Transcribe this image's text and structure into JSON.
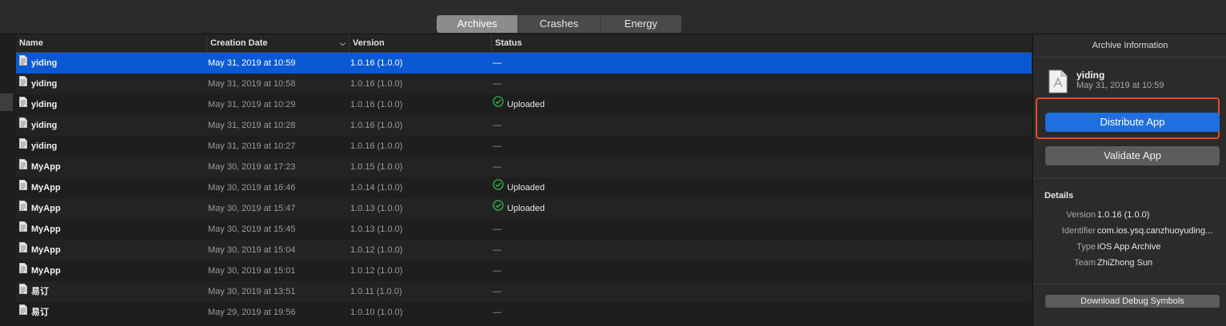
{
  "toolbar": {
    "tabs": [
      {
        "label": "Archives",
        "active": true
      },
      {
        "label": "Crashes",
        "active": false
      },
      {
        "label": "Energy",
        "active": false
      }
    ]
  },
  "table": {
    "columns": [
      "Name",
      "Creation Date",
      "Version",
      "Status"
    ],
    "rows": [
      {
        "name": "yiding",
        "date": "May 31, 2019 at 10:59",
        "version": "1.0.16 (1.0.0)",
        "status": "—",
        "uploaded": false,
        "selected": true
      },
      {
        "name": "yiding",
        "date": "May 31, 2019 at 10:58",
        "version": "1.0.16 (1.0.0)",
        "status": "—",
        "uploaded": false
      },
      {
        "name": "yiding",
        "date": "May 31, 2019 at 10:29",
        "version": "1.0.16 (1.0.0)",
        "status": "Uploaded",
        "uploaded": true
      },
      {
        "name": "yiding",
        "date": "May 31, 2019 at 10:28",
        "version": "1.0.16 (1.0.0)",
        "status": "—",
        "uploaded": false
      },
      {
        "name": "yiding",
        "date": "May 31, 2019 at 10:27",
        "version": "1.0.16 (1.0.0)",
        "status": "—",
        "uploaded": false
      },
      {
        "name": "MyApp",
        "date": "May 30, 2019 at 17:23",
        "version": "1.0.15 (1.0.0)",
        "status": "—",
        "uploaded": false
      },
      {
        "name": "MyApp",
        "date": "May 30, 2019 at 16:46",
        "version": "1.0.14 (1.0.0)",
        "status": "Uploaded",
        "uploaded": true
      },
      {
        "name": "MyApp",
        "date": "May 30, 2019 at 15:47",
        "version": "1.0.13 (1.0.0)",
        "status": "Uploaded",
        "uploaded": true
      },
      {
        "name": "MyApp",
        "date": "May 30, 2019 at 15:45",
        "version": "1.0.13 (1.0.0)",
        "status": "—",
        "uploaded": false
      },
      {
        "name": "MyApp",
        "date": "May 30, 2019 at 15:04",
        "version": "1.0.12 (1.0.0)",
        "status": "—",
        "uploaded": false
      },
      {
        "name": "MyApp",
        "date": "May 30, 2019 at 15:01",
        "version": "1.0.12 (1.0.0)",
        "status": "—",
        "uploaded": false
      },
      {
        "name": "易订",
        "date": "May 30, 2019 at 13:51",
        "version": "1.0.11 (1.0.0)",
        "status": "—",
        "uploaded": false
      },
      {
        "name": "易订",
        "date": "May 29, 2019 at 19:56",
        "version": "1.0.10 (1.0.0)",
        "status": "—",
        "uploaded": false
      }
    ]
  },
  "panel": {
    "title": "Archive Information",
    "archive_name": "yiding",
    "archive_date": "May 31, 2019 at 10:59",
    "distribute_label": "Distribute App",
    "validate_label": "Validate App",
    "details_heading": "Details",
    "details": [
      {
        "key": "Version",
        "value": "1.0.16 (1.0.0)"
      },
      {
        "key": "Identifier",
        "value": "com.ios.ysq.canzhuoyuding..."
      },
      {
        "key": "Type",
        "value": "iOS App Archive"
      },
      {
        "key": "Team",
        "value": "ZhiZhong Sun"
      }
    ],
    "download_label": "Download Debug Symbols"
  },
  "colors": {
    "selection": "#0a59d3",
    "accent_button": "#1f6fe0",
    "highlight_box": "#e44b23",
    "uploaded_check": "#2fb84a"
  }
}
